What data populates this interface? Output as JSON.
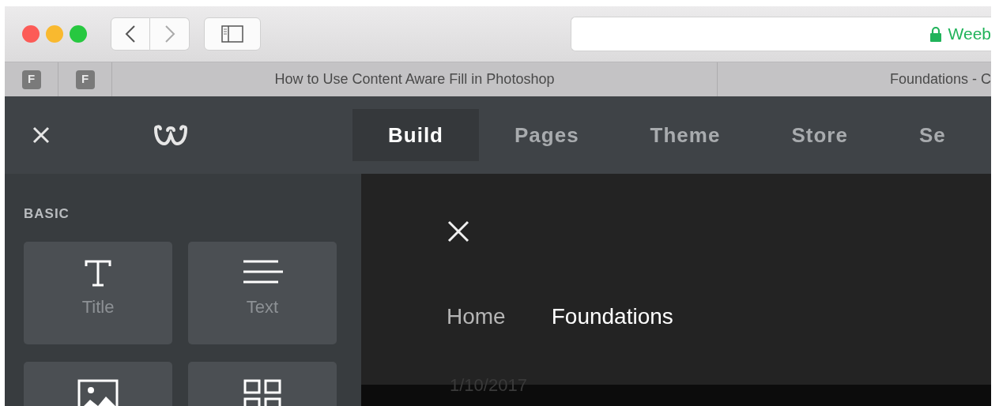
{
  "browser": {
    "url": "Weeb",
    "pinned_tabs": [
      "F",
      "F"
    ],
    "tabs": [
      {
        "label": "How to Use Content Aware Fill in Photoshop"
      },
      {
        "label": "Foundations - C"
      }
    ]
  },
  "editor_tabs": [
    {
      "label": "Build",
      "selected": true
    },
    {
      "label": "Pages",
      "selected": false
    },
    {
      "label": "Theme",
      "selected": false
    },
    {
      "label": "Store",
      "selected": false
    },
    {
      "label": "Se",
      "selected": false
    }
  ],
  "sidebar": {
    "section": "BASIC",
    "elements": [
      {
        "kind": "title",
        "label": "Title"
      },
      {
        "kind": "text",
        "label": "Text"
      },
      {
        "kind": "image"
      },
      {
        "kind": "gallery"
      }
    ]
  },
  "preview": {
    "menu": [
      {
        "label": "Home",
        "selected": false
      },
      {
        "label": "Foundations",
        "selected": true
      }
    ],
    "date": "1/10/2017"
  }
}
